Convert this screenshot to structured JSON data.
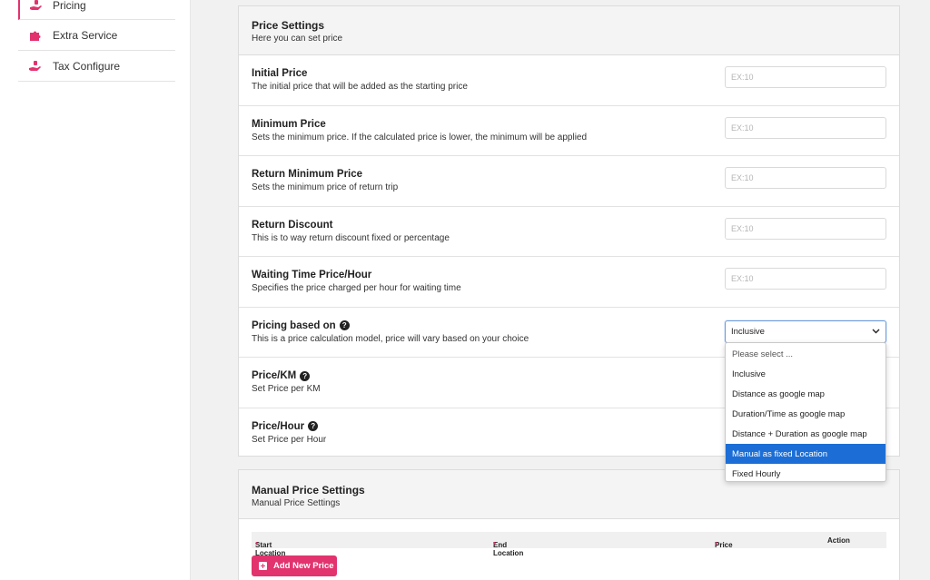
{
  "sidebar": {
    "items": [
      {
        "label": "Pricing",
        "icon": "hand-money-icon"
      },
      {
        "label": "Extra Service",
        "icon": "puzzle-icon"
      },
      {
        "label": "Tax Configure",
        "icon": "hand-money-icon"
      }
    ]
  },
  "price_settings": {
    "title": "Price Settings",
    "subtitle": "Here you can set price",
    "rows": [
      {
        "title": "Initial Price",
        "desc": "The initial price that will be added as the starting price",
        "placeholder": "EX:10"
      },
      {
        "title": "Minimum Price",
        "desc": "Sets the minimum price. If the calculated price is lower, the minimum will be applied",
        "placeholder": "EX:10"
      },
      {
        "title": "Return Minimum Price",
        "desc": "Sets the minimum price of return trip",
        "placeholder": "EX:10"
      },
      {
        "title": "Return Discount",
        "desc": "This is to way return discount fixed or percentage",
        "placeholder": "EX:10"
      },
      {
        "title": "Waiting Time Price/Hour",
        "desc": "Specifies the price charged per hour for waiting time",
        "placeholder": "EX:10"
      },
      {
        "title": "Pricing based on",
        "desc": "This is a price calculation model, price will vary based on your choice",
        "value": "Inclusive"
      },
      {
        "title": "Price/KM",
        "desc": "Set Price per KM"
      },
      {
        "title": "Price/Hour",
        "desc": "Set Price per Hour"
      }
    ]
  },
  "dropdown": {
    "options": [
      "Please select ...",
      "Inclusive",
      "Distance as google map",
      "Duration/Time as google map",
      "Distance + Duration as google map",
      "Manual as fixed Location",
      "Fixed Hourly"
    ],
    "highlighted": "Manual as fixed Location"
  },
  "manual_price": {
    "title": "Manual Price Settings",
    "subtitle": "Manual Price Settings",
    "columns": [
      "Start Location",
      "End Location",
      "Price",
      "Action"
    ],
    "required_mark": "*",
    "add_button": "Add New Price"
  },
  "colors": {
    "accent": "#e2336f",
    "selected": "#1c6ed6"
  }
}
